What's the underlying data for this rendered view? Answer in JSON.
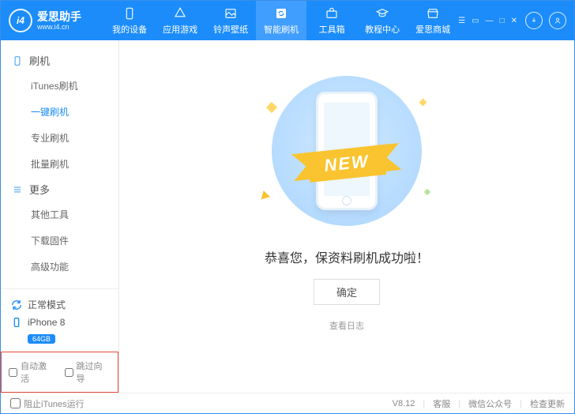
{
  "brand": {
    "name": "爱思助手",
    "sub": "www.i4.cn",
    "logo": "i4"
  },
  "nav": [
    {
      "label": "我的设备"
    },
    {
      "label": "应用游戏"
    },
    {
      "label": "铃声壁纸"
    },
    {
      "label": "智能刷机",
      "active": true
    },
    {
      "label": "工具箱"
    },
    {
      "label": "教程中心"
    },
    {
      "label": "爱思商城"
    }
  ],
  "sidebar": {
    "group1": {
      "title": "刷机",
      "items": [
        "iTunes刷机",
        "一键刷机",
        "专业刷机",
        "批量刷机"
      ],
      "activeIndex": 1
    },
    "group2": {
      "title": "更多",
      "items": [
        "其他工具",
        "下载固件",
        "高级功能"
      ]
    },
    "mode": "正常模式",
    "device": "iPhone 8",
    "storage": "64GB",
    "checks": {
      "auto_activate": "自动激活",
      "skip_guide": "跳过向导"
    }
  },
  "main": {
    "ribbon": "NEW",
    "success": "恭喜您，保资料刷机成功啦！",
    "ok": "确定",
    "log": "查看日志"
  },
  "footer": {
    "block_itunes": "阻止iTunes运行",
    "version": "V8.12",
    "support": "客服",
    "wechat": "微信公众号",
    "update": "检查更新"
  }
}
